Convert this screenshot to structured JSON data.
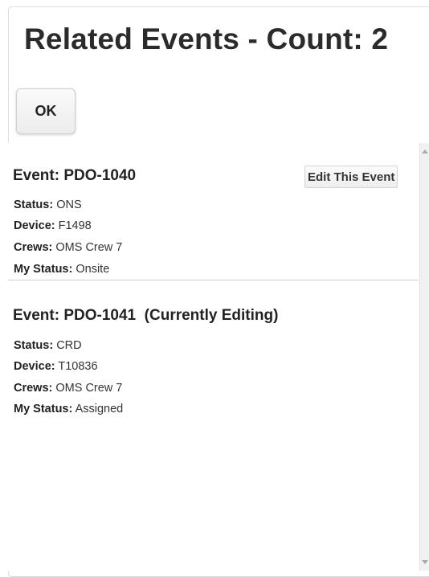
{
  "header": {
    "title": "Related Events - Count: 2"
  },
  "actions": {
    "ok_label": "OK"
  },
  "events": [
    {
      "title": "Event: PDO-1040",
      "edit_label": "Edit This Event",
      "status_label": "Status:",
      "status": "ONS",
      "device_label": "Device:",
      "device": "F1498",
      "crews_label": "Crews:",
      "crews": "OMS Crew 7",
      "my_status_label": "My Status:",
      "my_status": "Onsite"
    },
    {
      "title": "Event: PDO-1041  (Currently Editing)",
      "status_label": "Status:",
      "status": "CRD",
      "device_label": "Device:",
      "device": "T10836",
      "crews_label": "Crews:",
      "crews": "OMS Crew 7",
      "my_status_label": "My Status:",
      "my_status": "Assigned"
    }
  ],
  "icons": {
    "scroll_up": "chevron-up-icon",
    "scroll_down": "chevron-down-icon"
  }
}
